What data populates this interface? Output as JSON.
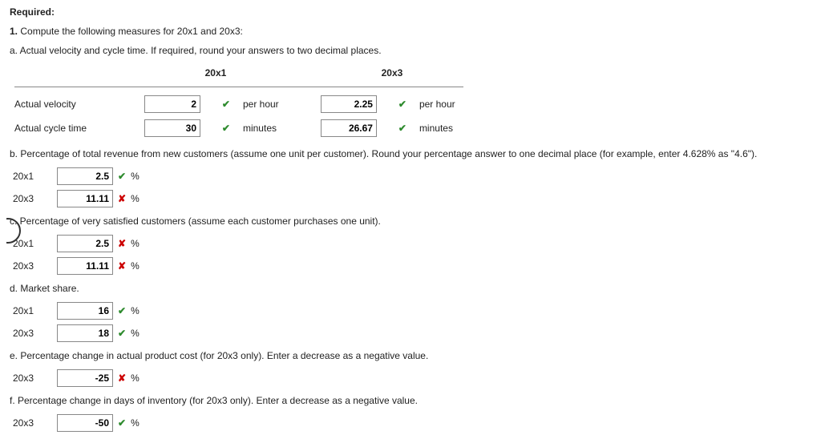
{
  "header": {
    "required": "Required:",
    "q1": "1.",
    "q1text": "Compute the following measures for 20x1 and 20x3:"
  },
  "a": {
    "prompt": "a. Actual velocity and cycle time. If required, round your answers to two decimal places.",
    "col1": "20x1",
    "col2": "20x3",
    "row1": {
      "label": "Actual velocity",
      "v1": "2",
      "v2": "2.25",
      "unit": "per hour"
    },
    "row2": {
      "label": "Actual cycle time",
      "v1": "30",
      "v2": "26.67",
      "unit": "minutes"
    }
  },
  "b": {
    "prompt": "b. Percentage of total revenue from new customers (assume one unit per customer). Round your percentage answer to one decimal place (for example, enter 4.628% as \"4.6\").",
    "r1": {
      "yr": "20x1",
      "v": "2.5",
      "ok": true
    },
    "r2": {
      "yr": "20x3",
      "v": "11.11",
      "ok": false
    }
  },
  "c": {
    "prompt": "c. Percentage of very satisfied customers (assume each customer purchases one unit).",
    "r1": {
      "yr": "20x1",
      "v": "2.5",
      "ok": false
    },
    "r2": {
      "yr": "20x3",
      "v": "11.11",
      "ok": false
    }
  },
  "d": {
    "prompt": "d. Market share.",
    "r1": {
      "yr": "20x1",
      "v": "16",
      "ok": true
    },
    "r2": {
      "yr": "20x3",
      "v": "18",
      "ok": true
    }
  },
  "e": {
    "prompt": "e. Percentage change in actual product cost (for 20x3 only). Enter a decrease as a negative value.",
    "r1": {
      "yr": "20x3",
      "v": "-25",
      "ok": false
    }
  },
  "f": {
    "prompt": "f. Percentage change in days of inventory (for 20x3 only). Enter a decrease as a negative value.",
    "r1": {
      "yr": "20x3",
      "v": "-50",
      "ok": true
    }
  },
  "sym": {
    "pct": "%",
    "check": "✔",
    "cross": "✘"
  }
}
